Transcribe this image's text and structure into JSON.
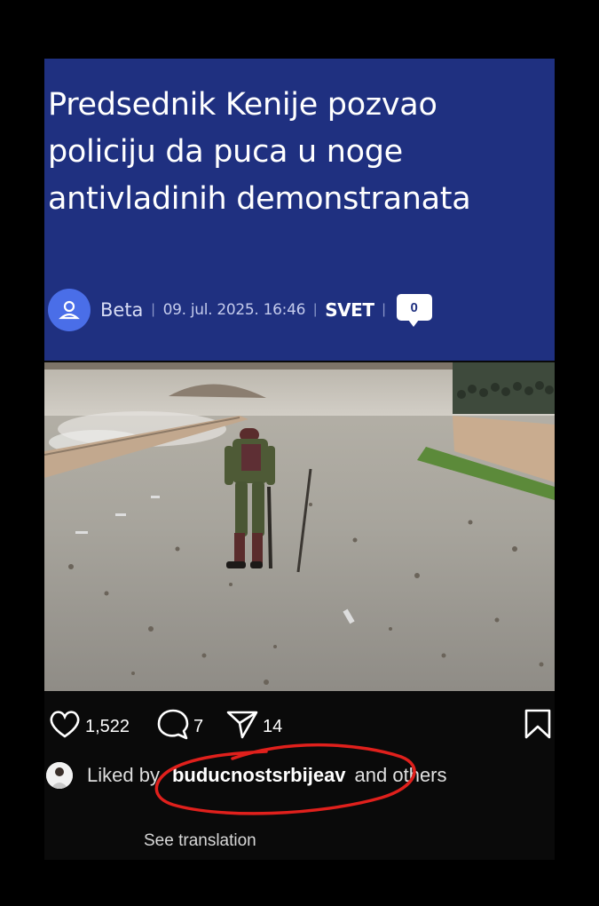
{
  "article": {
    "headline": "Predsednik Kenije pozvao policiju da puca u noge antivladinih demonstranata",
    "author": "Beta",
    "date": "09. jul. 2025. 16:46",
    "section": "SVET",
    "comment_count": "0",
    "avatar_icon": "user-icon",
    "header_color": "#1f3080"
  },
  "post": {
    "likes": "1,522",
    "comments": "7",
    "shares": "14",
    "liked_prefix": "Liked by",
    "liked_user": "buducnostsrbijeav",
    "liked_suffix": "and others",
    "see_translation": "See translation",
    "icons": [
      "heart-icon",
      "comment-icon",
      "share-icon",
      "bookmark-icon"
    ]
  },
  "annotation": {
    "color": "#e0201c"
  }
}
